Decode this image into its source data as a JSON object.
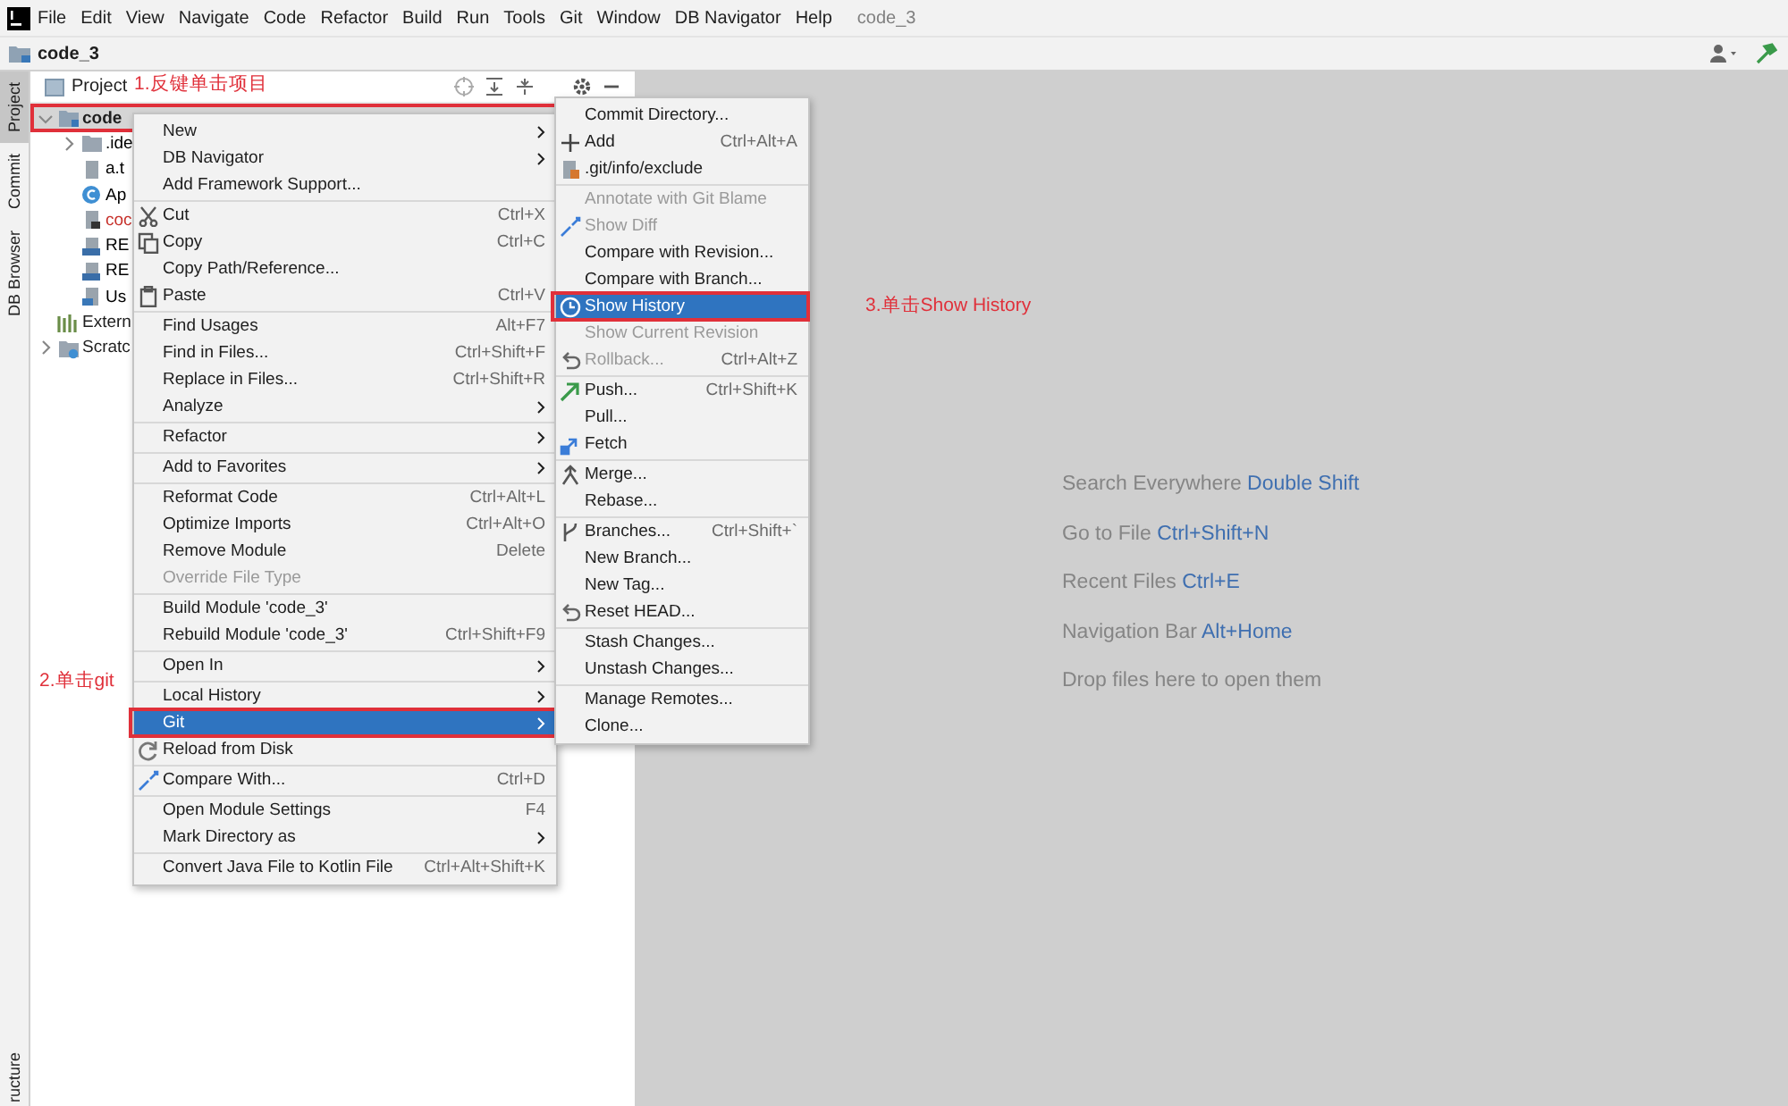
{
  "menu_bar": {
    "items": [
      "File",
      "Edit",
      "View",
      "Navigate",
      "Code",
      "Refactor",
      "Build",
      "Run",
      "Tools",
      "Git",
      "Window",
      "DB Navigator",
      "Help"
    ],
    "title": "code_3"
  },
  "nav_bar": {
    "crumb": "code_3"
  },
  "tool_stripe": {
    "tabs": [
      {
        "label": "Project",
        "selected": true
      },
      {
        "label": "Commit",
        "selected": false
      },
      {
        "label": "DB Browser",
        "selected": false
      }
    ],
    "bottom_tab": "ructure"
  },
  "project_panel": {
    "title": "Project",
    "tree": [
      {
        "label": "code",
        "kind": "module",
        "expanded": true,
        "selected": true,
        "annotated": true,
        "children": [
          {
            "label": ".ide",
            "kind": "folder",
            "expanded": false,
            "color": "#000000"
          },
          {
            "label": "a.t",
            "kind": "text-file",
            "color": "#000000"
          },
          {
            "label": "Ap",
            "kind": "class",
            "color": "#000000"
          },
          {
            "label": "coc",
            "kind": "module-file",
            "color": "#c7302a"
          },
          {
            "label": "RE",
            "kind": "markdown",
            "color": "#000000"
          },
          {
            "label": "RE",
            "kind": "markdown",
            "color": "#000000"
          },
          {
            "label": "Us",
            "kind": "java-file",
            "color": "#000000"
          }
        ]
      },
      {
        "label": "Extern",
        "kind": "libraries",
        "selected": false
      },
      {
        "label": "Scratc",
        "kind": "scratches",
        "expanded": false,
        "selected": false
      }
    ]
  },
  "context_menu": {
    "items": [
      {
        "kind": "item",
        "label": "New",
        "submenu": true,
        "disabled": false,
        "selected": false
      },
      {
        "kind": "item",
        "label": "DB Navigator",
        "submenu": true,
        "disabled": false,
        "selected": false
      },
      {
        "kind": "item",
        "label": "Add Framework Support...",
        "submenu": false,
        "disabled": false,
        "selected": false
      },
      {
        "kind": "separator"
      },
      {
        "kind": "cut",
        "label": "Cut",
        "shortcut": "Ctrl+X",
        "submenu": false,
        "disabled": false,
        "selected": false
      },
      {
        "kind": "copy",
        "label": "Copy",
        "shortcut": "Ctrl+C",
        "submenu": false,
        "disabled": false,
        "selected": false
      },
      {
        "kind": "item",
        "label": "Copy Path/Reference...",
        "submenu": false,
        "disabled": false,
        "selected": false
      },
      {
        "kind": "paste",
        "label": "Paste",
        "shortcut": "Ctrl+V",
        "submenu": false,
        "disabled": false,
        "selected": false
      },
      {
        "kind": "separator"
      },
      {
        "kind": "item",
        "label": "Find Usages",
        "shortcut": "Alt+F7",
        "submenu": false,
        "disabled": false,
        "selected": false
      },
      {
        "kind": "item",
        "label": "Find in Files...",
        "shortcut": "Ctrl+Shift+F",
        "submenu": false,
        "disabled": false,
        "selected": false
      },
      {
        "kind": "item",
        "label": "Replace in Files...",
        "shortcut": "Ctrl+Shift+R",
        "submenu": false,
        "disabled": false,
        "selected": false
      },
      {
        "kind": "item",
        "label": "Analyze",
        "submenu": true,
        "disabled": false,
        "selected": false
      },
      {
        "kind": "separator"
      },
      {
        "kind": "item",
        "label": "Refactor",
        "submenu": true,
        "disabled": false,
        "selected": false
      },
      {
        "kind": "separator"
      },
      {
        "kind": "item",
        "label": "Add to Favorites",
        "submenu": true,
        "disabled": false,
        "selected": false
      },
      {
        "kind": "separator"
      },
      {
        "kind": "item",
        "label": "Reformat Code",
        "shortcut": "Ctrl+Alt+L",
        "submenu": false,
        "disabled": false,
        "selected": false
      },
      {
        "kind": "item",
        "label": "Optimize Imports",
        "shortcut": "Ctrl+Alt+O",
        "submenu": false,
        "disabled": false,
        "selected": false
      },
      {
        "kind": "item",
        "label": "Remove Module",
        "shortcut": "Delete",
        "submenu": false,
        "disabled": false,
        "selected": false
      },
      {
        "kind": "item",
        "label": "Override File Type",
        "submenu": false,
        "disabled": true,
        "selected": false
      },
      {
        "kind": "separator"
      },
      {
        "kind": "item",
        "label": "Build Module 'code_3'",
        "submenu": false,
        "disabled": false,
        "selected": false
      },
      {
        "kind": "item",
        "label": "Rebuild Module 'code_3'",
        "shortcut": "Ctrl+Shift+F9",
        "submenu": false,
        "disabled": false,
        "selected": false
      },
      {
        "kind": "separator"
      },
      {
        "kind": "item",
        "label": "Open In",
        "submenu": true,
        "disabled": false,
        "selected": false
      },
      {
        "kind": "separator"
      },
      {
        "kind": "item",
        "label": "Local History",
        "submenu": true,
        "disabled": false,
        "selected": false
      },
      {
        "kind": "item",
        "label": "Git",
        "submenu": true,
        "disabled": false,
        "selected": true,
        "annotated": true
      },
      {
        "kind": "reload",
        "label": "Reload from Disk",
        "submenu": false,
        "disabled": false,
        "selected": false
      },
      {
        "kind": "separator"
      },
      {
        "kind": "compare",
        "label": "Compare With...",
        "shortcut": "Ctrl+D",
        "submenu": false,
        "disabled": false,
        "selected": false
      },
      {
        "kind": "separator"
      },
      {
        "kind": "item",
        "label": "Open Module Settings",
        "shortcut": "F4",
        "submenu": false,
        "disabled": false,
        "selected": false
      },
      {
        "kind": "item",
        "label": "Mark Directory as",
        "submenu": true,
        "disabled": false,
        "selected": false
      },
      {
        "kind": "separator"
      },
      {
        "kind": "item",
        "label": "Convert Java File to Kotlin File",
        "shortcut": "Ctrl+Alt+Shift+K",
        "submenu": false,
        "disabled": false,
        "selected": false
      }
    ]
  },
  "git_submenu": {
    "items": [
      {
        "kind": "item",
        "label": "Commit Directory...",
        "disabled": false,
        "selected": false
      },
      {
        "kind": "add",
        "label": "Add",
        "shortcut": "Ctrl+Alt+A",
        "disabled": false,
        "selected": false
      },
      {
        "kind": "exclude",
        "label": ".git/info/exclude",
        "disabled": false,
        "selected": false
      },
      {
        "kind": "separator"
      },
      {
        "kind": "item",
        "label": "Annotate with Git Blame",
        "disabled": true,
        "selected": false
      },
      {
        "kind": "compare",
        "label": "Show Diff",
        "disabled": true,
        "selected": false
      },
      {
        "kind": "item",
        "label": "Compare with Revision...",
        "disabled": false,
        "selected": false
      },
      {
        "kind": "item",
        "label": "Compare with Branch...",
        "disabled": false,
        "selected": false
      },
      {
        "kind": "history",
        "label": "Show History",
        "disabled": false,
        "selected": true,
        "annotated": true
      },
      {
        "kind": "item",
        "label": "Show Current Revision",
        "disabled": true,
        "selected": false
      },
      {
        "kind": "rollback",
        "label": "Rollback...",
        "shortcut": "Ctrl+Alt+Z",
        "disabled": true,
        "selected": false
      },
      {
        "kind": "separator"
      },
      {
        "kind": "push",
        "label": "Push...",
        "shortcut": "Ctrl+Shift+K",
        "disabled": false,
        "selected": false
      },
      {
        "kind": "item",
        "label": "Pull...",
        "disabled": false,
        "selected": false
      },
      {
        "kind": "fetch",
        "label": "Fetch",
        "disabled": false,
        "selected": false
      },
      {
        "kind": "separator"
      },
      {
        "kind": "merge",
        "label": "Merge...",
        "disabled": false,
        "selected": false
      },
      {
        "kind": "item",
        "label": "Rebase...",
        "disabled": false,
        "selected": false
      },
      {
        "kind": "separator"
      },
      {
        "kind": "branches",
        "label": "Branches...",
        "shortcut": "Ctrl+Shift+`",
        "disabled": false,
        "selected": false
      },
      {
        "kind": "item",
        "label": "New Branch...",
        "disabled": false,
        "selected": false
      },
      {
        "kind": "item",
        "label": "New Tag...",
        "disabled": false,
        "selected": false
      },
      {
        "kind": "rollback",
        "label": "Reset HEAD...",
        "disabled": false,
        "selected": false
      },
      {
        "kind": "separator"
      },
      {
        "kind": "item",
        "label": "Stash Changes...",
        "disabled": false,
        "selected": false
      },
      {
        "kind": "item",
        "label": "Unstash Changes...",
        "disabled": false,
        "selected": false
      },
      {
        "kind": "separator"
      },
      {
        "kind": "item",
        "label": "Manage Remotes...",
        "disabled": false,
        "selected": false
      },
      {
        "kind": "item",
        "label": "Clone...",
        "disabled": false,
        "selected": false
      }
    ]
  },
  "editor_hints": [
    {
      "text": "Search Everywhere",
      "shortcut": "Double Shift"
    },
    {
      "text": "Go to File",
      "shortcut": "Ctrl+Shift+N"
    },
    {
      "text": "Recent Files",
      "shortcut": "Ctrl+E"
    },
    {
      "text": "Navigation Bar",
      "shortcut": "Alt+Home"
    },
    {
      "text": "Drop files here to open them"
    }
  ],
  "annotations": [
    "1.反键单击项目",
    "2.单击git",
    "3.单击Show History"
  ]
}
